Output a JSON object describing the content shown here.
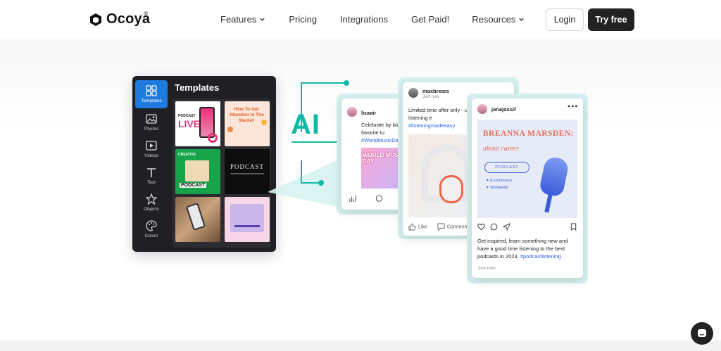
{
  "brand": {
    "name": "Ocoya",
    "registered": "®"
  },
  "nav": {
    "items": [
      {
        "label": "Features",
        "dropdown": true
      },
      {
        "label": "Pricing",
        "dropdown": false
      },
      {
        "label": "Integrations",
        "dropdown": false
      },
      {
        "label": "Get Paid!",
        "dropdown": false
      },
      {
        "label": "Resources",
        "dropdown": true
      }
    ],
    "login": "Login",
    "try_free": "Try free"
  },
  "templates_panel": {
    "title": "Templates",
    "sidebar": [
      {
        "label": "Templates",
        "icon": "templates-icon",
        "active": true
      },
      {
        "label": "Photos",
        "icon": "photo-icon",
        "active": false
      },
      {
        "label": "Videos",
        "icon": "video-icon",
        "active": false
      },
      {
        "label": "Text",
        "icon": "text-icon",
        "active": false
      },
      {
        "label": "Objects",
        "icon": "star-icon",
        "active": false
      },
      {
        "label": "Colors",
        "icon": "palette-icon",
        "active": false
      }
    ],
    "thumbs": {
      "t1_small": "PODCAST",
      "t1_big": "LIVE",
      "t2_text": "How To Get Attention In The Market",
      "t3_top": "CREATIVE",
      "t3_label": "PODCAST",
      "t4_text": "PODCAST"
    }
  },
  "ai_label": "AI",
  "posts": {
    "p1": {
      "user": "lizaair",
      "text": "Celebrate by bla your favorite tu",
      "tag": "#WorldMusicDa",
      "image_text": "WORLD MUSIC DAY"
    },
    "p2": {
      "user": "maxbrears",
      "time": "Just now",
      "text": "Limited time offer only - upgrade your listening e",
      "tag": "#listeningmadeeasy",
      "like": "Like",
      "comment": "Commen"
    },
    "p3": {
      "user": "janajossif",
      "image_title": "BREANNA MARSDEN:",
      "image_sub": "about career",
      "pill": "PODCAST",
      "list": [
        "E-commerce",
        "Worldwide"
      ],
      "caption": "Get inspired, learn something new and have a good time listening to the best podcasts in 2023.",
      "tag": "#podcastlistening",
      "time": "Just now"
    }
  },
  "colors": {
    "accent": "#14b8a6",
    "active_blue": "#1f7ae0",
    "tag_blue": "#2563eb",
    "dark": "#222222"
  }
}
